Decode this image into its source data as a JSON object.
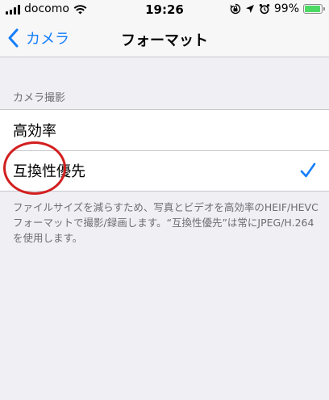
{
  "status_bar": {
    "carrier": "docomo",
    "time": "19:26",
    "battery_percent": "99%",
    "battery_level": 0.99,
    "icons": [
      "signal-icon",
      "wifi-icon",
      "orientation-lock-icon",
      "location-icon",
      "alarm-icon",
      "battery-icon"
    ],
    "battery_color": "#4cd964"
  },
  "nav": {
    "back_label": "カメラ",
    "title": "フォーマット",
    "accent_color": "#147efb"
  },
  "section": {
    "header": "カメラ撮影",
    "options": [
      {
        "label": "高効率",
        "selected": false
      },
      {
        "label": "互換性優先",
        "selected": true
      }
    ],
    "footer": "ファイルサイズを減らすため、写真とビデオを高効率のHEIF/HEVCフォーマットで撮影/録画します。“互換性優先”は常にJPEG/H.264を使用します。"
  }
}
